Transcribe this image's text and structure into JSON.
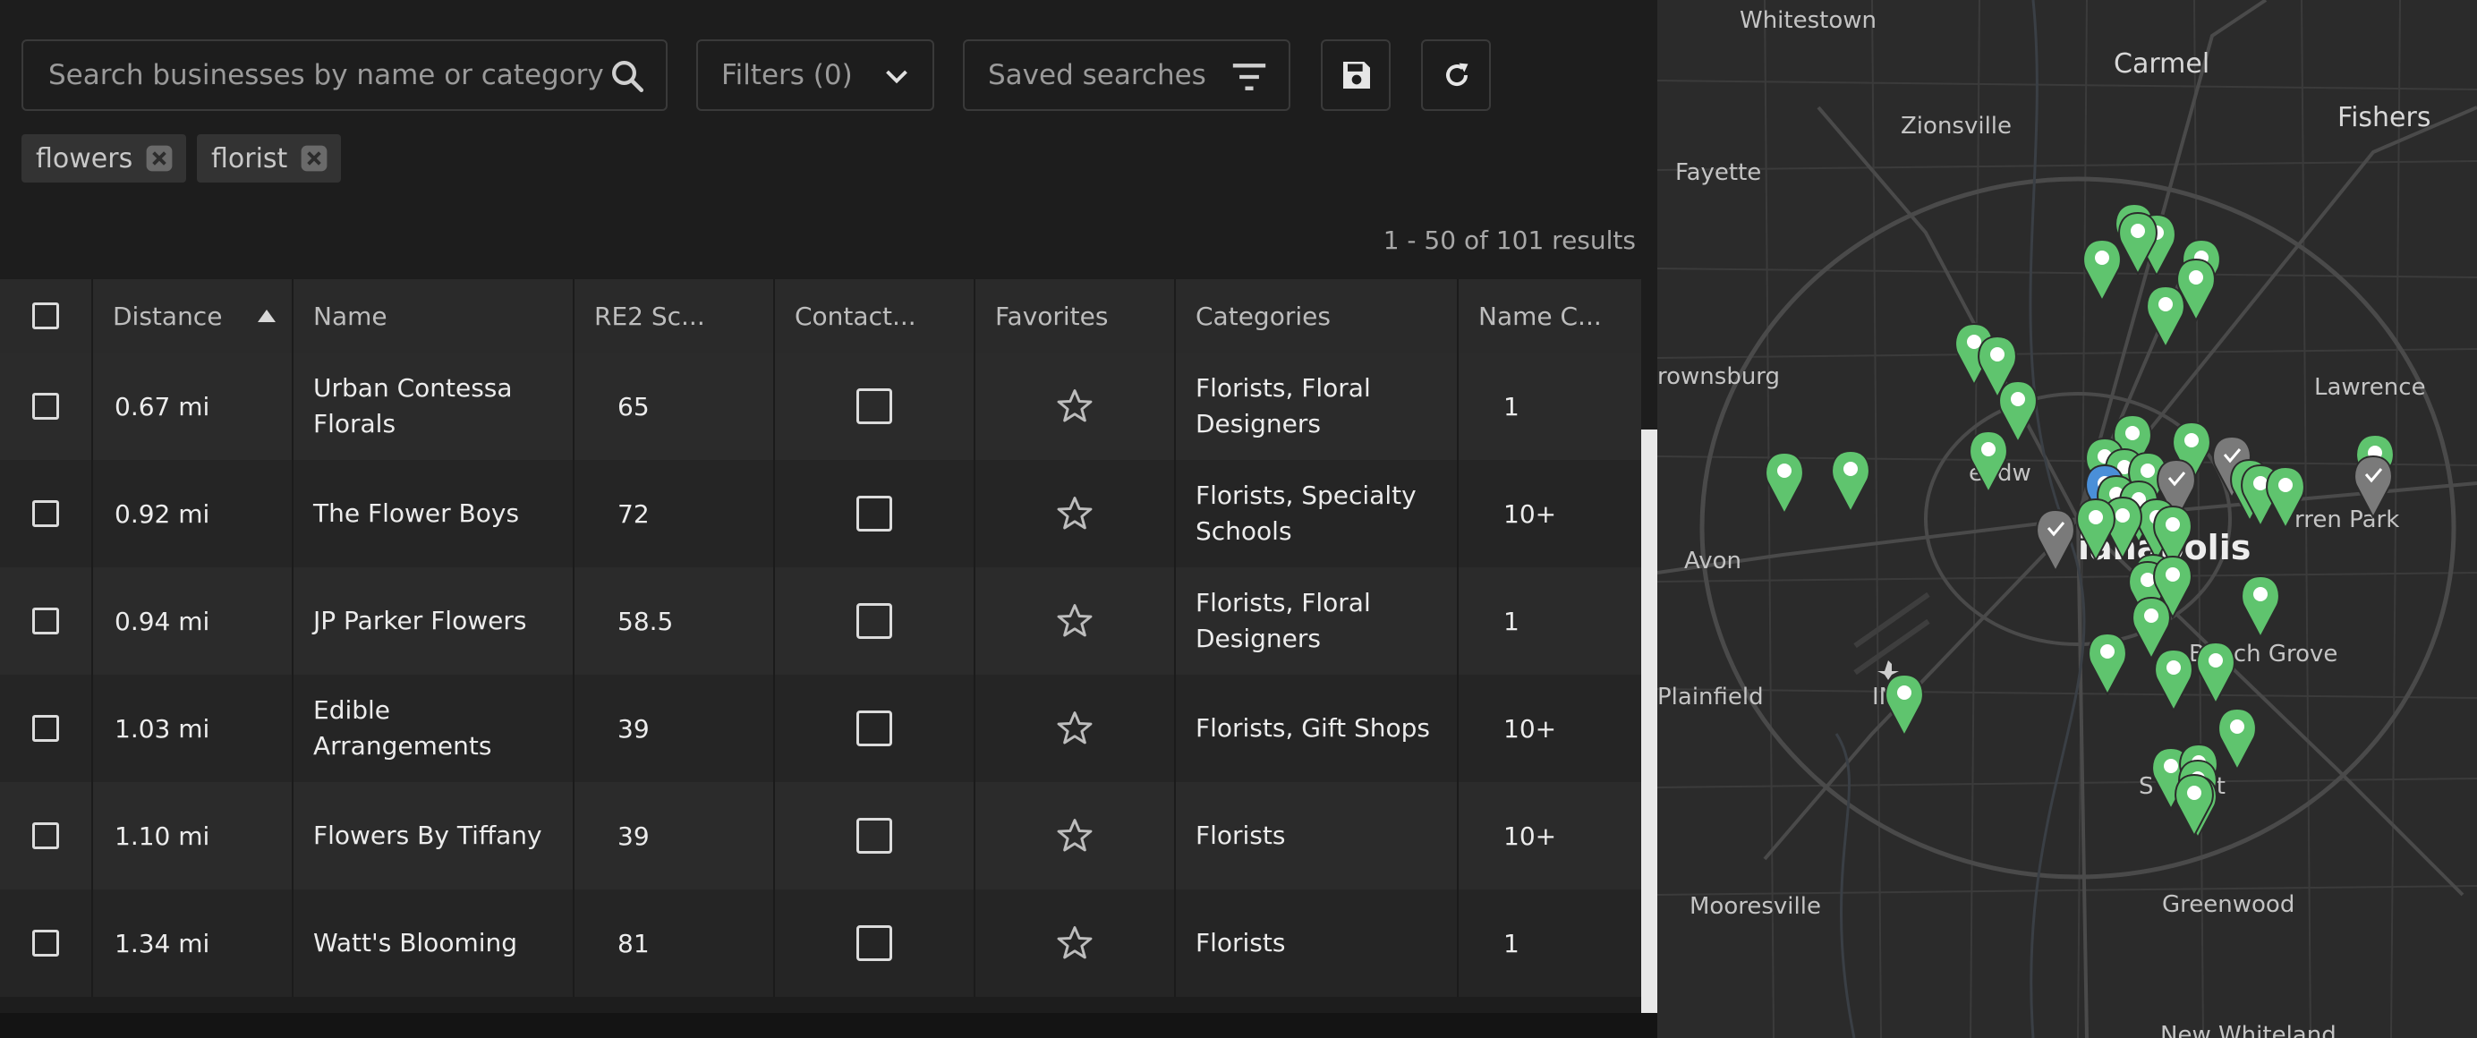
{
  "search": {
    "placeholder": "Search businesses by name or category",
    "icon": "search-icon"
  },
  "filters": {
    "label": "Filters (0)",
    "icon": "chevron-down-icon"
  },
  "saved_searches": {
    "label": "Saved searches",
    "icon": "filter-lines-icon"
  },
  "toolbar": {
    "save_icon": "floppy-disk-icon",
    "refresh_icon": "refresh-icon"
  },
  "chips": [
    {
      "label": "flowers"
    },
    {
      "label": "florist"
    }
  ],
  "results_text": "1 - 50 of 101 results",
  "table": {
    "headers": {
      "distance": "Distance",
      "name": "Name",
      "re2": "RE2 Sc...",
      "contact": "Contact...",
      "favorites": "Favorites",
      "categories": "Categories",
      "name_count": "Name C..."
    },
    "sort": {
      "column": "Distance",
      "direction": "ascending"
    },
    "rows": [
      {
        "distance": "0.67 mi",
        "name": "Urban Contessa Florals",
        "re2": "65",
        "categories": "Florists, Floral Designers",
        "name_count": "1"
      },
      {
        "distance": "0.92 mi",
        "name": "The Flower Boys",
        "re2": "72",
        "categories": "Florists, Specialty Schools",
        "name_count": "10+"
      },
      {
        "distance": "0.94 mi",
        "name": "JP Parker Flowers",
        "re2": "58.5",
        "categories": "Florists, Floral Designers",
        "name_count": "1"
      },
      {
        "distance": "1.03 mi",
        "name": "Edible Arrangements",
        "re2": "39",
        "categories": "Florists, Gift Shops",
        "name_count": "10+"
      },
      {
        "distance": "1.10 mi",
        "name": "Flowers By Tiffany",
        "re2": "39",
        "categories": "Florists",
        "name_count": "10+"
      },
      {
        "distance": "1.34 mi",
        "name": "Watt's Blooming",
        "re2": "81",
        "categories": "Florists",
        "name_count": "1"
      }
    ]
  },
  "map": {
    "labels": {
      "whitestown": "Whitestown",
      "carmel": "Carmel",
      "fishers": "Fishers",
      "zionsville": "Zionsville",
      "fayette": "Fayette",
      "brownsburg": "rownsburg",
      "lawrence": "Lawrence",
      "avon": "Avon",
      "indianapolis": "ianapolis",
      "beech_grove": "Beech Grove",
      "plainfield": "Plainfield",
      "warren_park": "rren Park",
      "speedway": "eedw",
      "ind": "IN",
      "southport": "S",
      "southport2": "rt",
      "mooresville": "Mooresville",
      "greenwood": "Greenwood",
      "new_whiteland": "New Whiteland"
    },
    "colors": {
      "marker_green": "#5fc46e",
      "marker_gray": "#7a7a7a",
      "marker_blue": "#4a8fd8",
      "background": "#2b2b2b"
    },
    "marker_icon": "map-pin-icon"
  }
}
